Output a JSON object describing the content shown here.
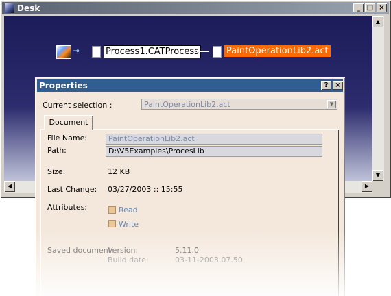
{
  "desk": {
    "title": "Desk",
    "buttons": {
      "minimize": "_",
      "maximize": "□",
      "close": "×"
    },
    "tree": {
      "root_node": "Process1.CATProcess",
      "child_node": "PaintOperationLib2.act"
    }
  },
  "properties": {
    "title": "Properties",
    "help_button": "?",
    "close_button": "×",
    "current_selection_label": "Current selection :",
    "current_selection_value": "PaintOperationLib2.act",
    "tab": "Document",
    "file_name_label": "File Name:",
    "file_name_value": "PaintOperationLib2.act",
    "path_label": "Path:",
    "path_value": "D:\\V5Examples\\ProcesLib",
    "size_label": "Size:",
    "size_value": "12 KB",
    "last_change_label": "Last Change:",
    "last_change_value": "03/27/2003 :: 15:55",
    "attributes_label": "Attributes:",
    "attr_read": "Read",
    "attr_write": "Write",
    "saved_document_label": "Saved document:",
    "version_label": "Version:",
    "version_value": "5.11.0",
    "build_date_label": "Build date:",
    "build_date_value": "03-11-2003.07.50"
  },
  "colors": {
    "selection_highlight": "#ff6a00",
    "dialog_titlebar": "#315e92",
    "dialog_background": "#f4e8dc"
  }
}
